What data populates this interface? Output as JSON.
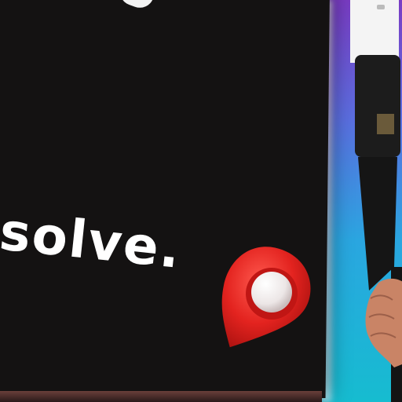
{
  "caption": {
    "text": "solve."
  },
  "colors": {
    "board": "#141212",
    "pin_red": "#e3231f",
    "pin_dark_red": "#a8110f",
    "pin_ball": "#f1eeee",
    "background_purple": "#6a2fb0",
    "background_cyan": "#19b9c9"
  },
  "icons": [
    "location-pin-icon"
  ]
}
